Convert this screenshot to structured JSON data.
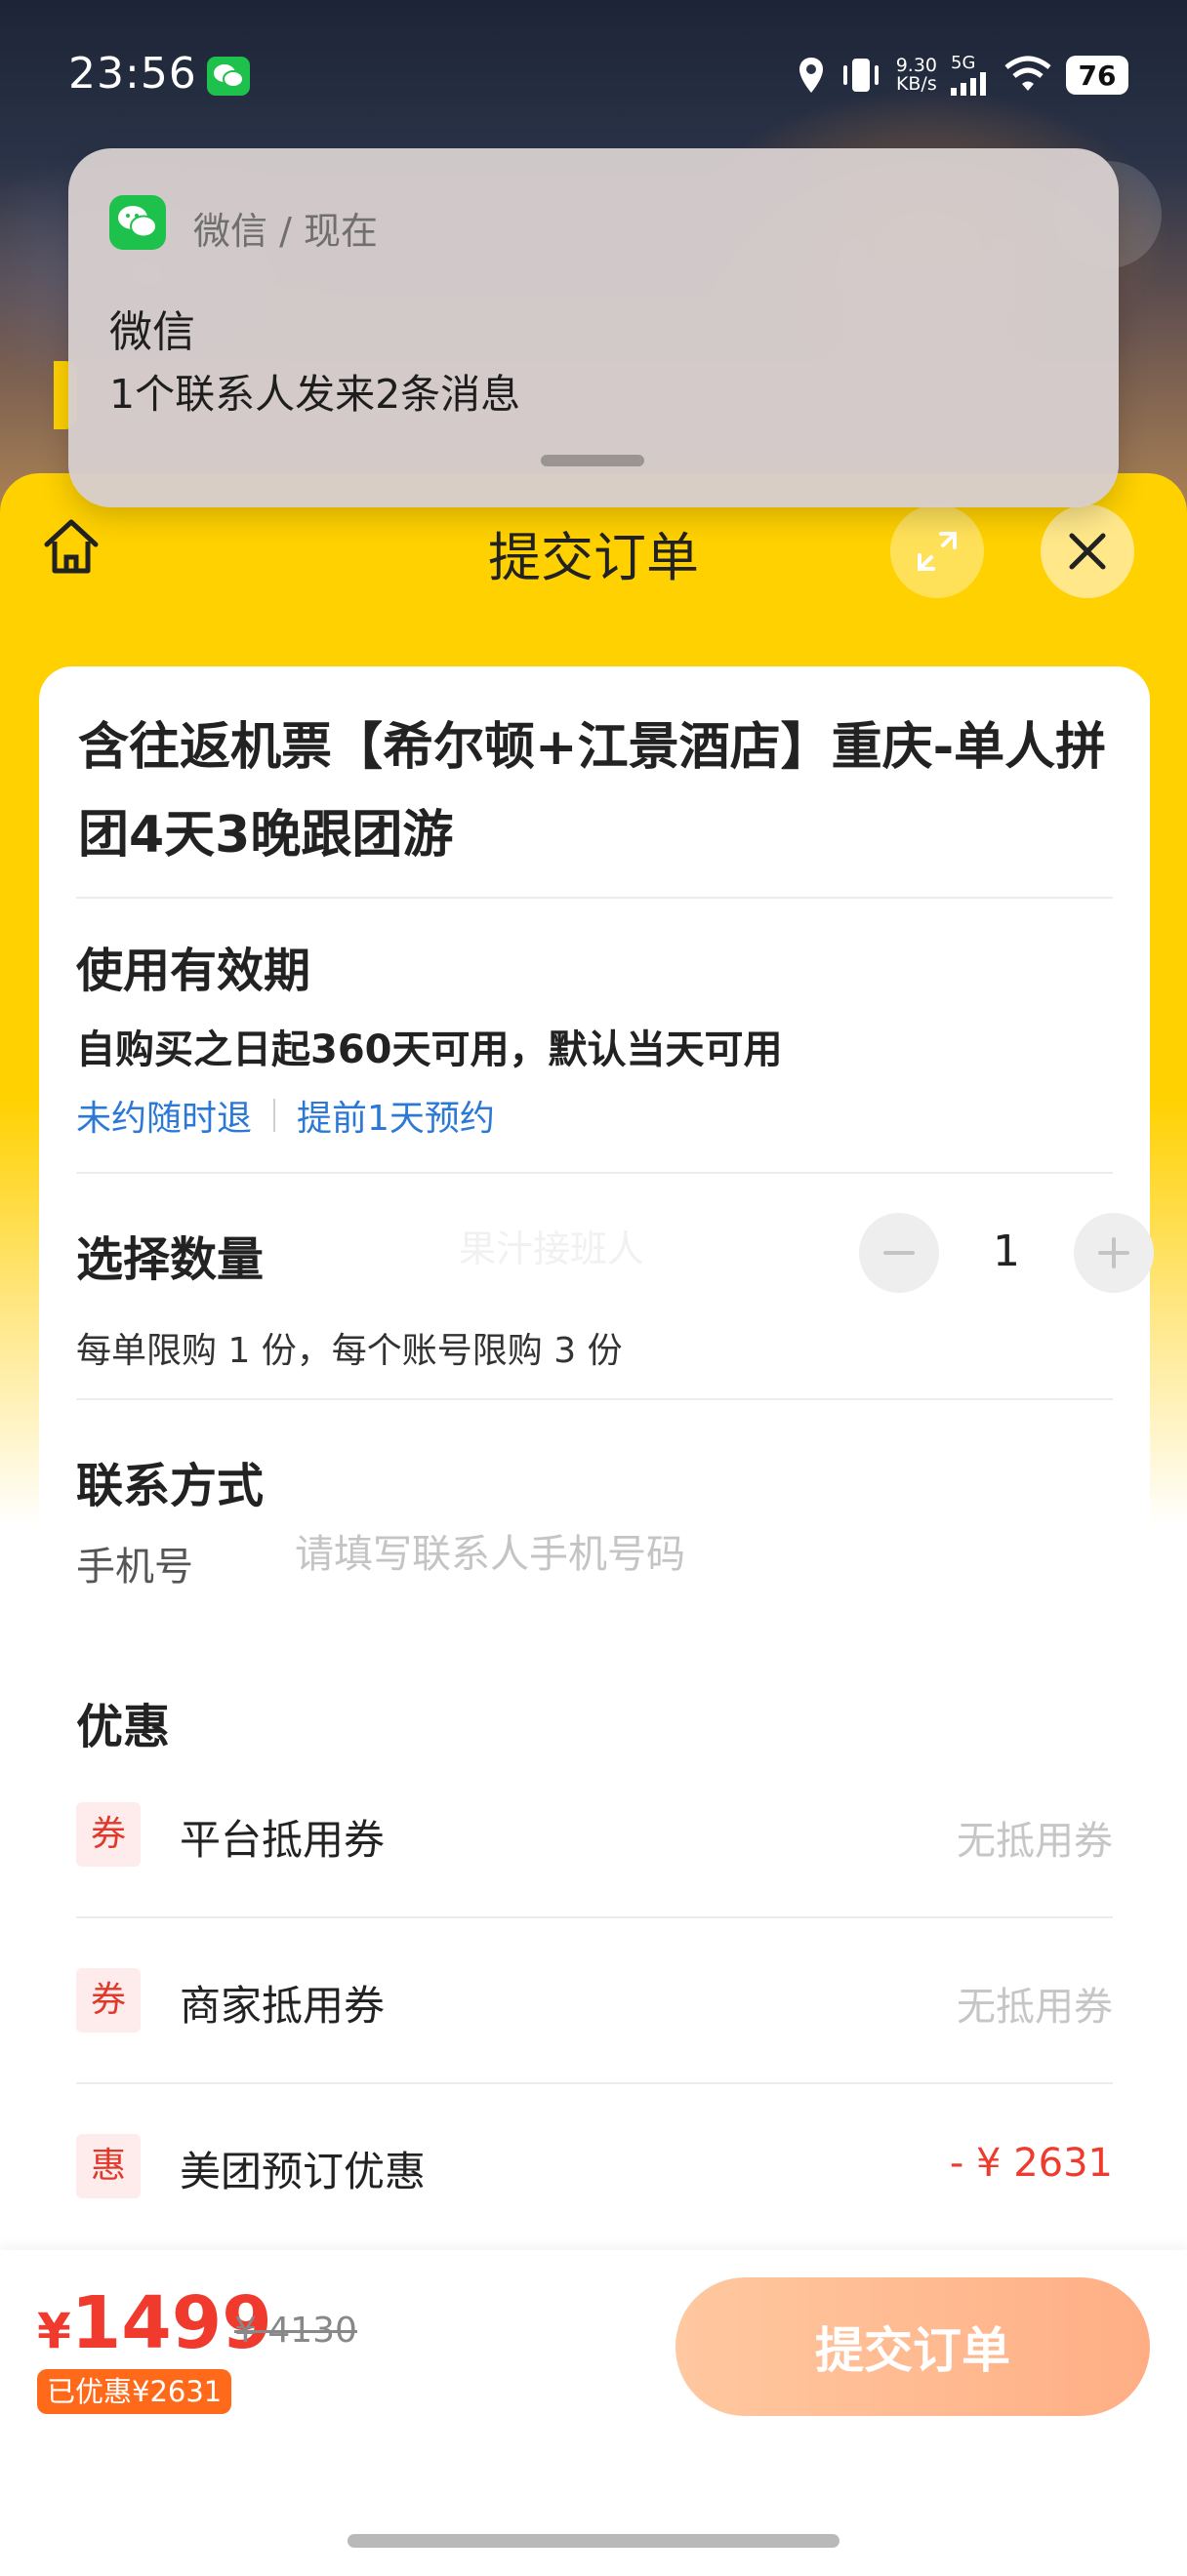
{
  "status_bar": {
    "time": "23:56",
    "net_speed_value": "9.30",
    "net_speed_unit": "KB/s",
    "network": "5G",
    "battery": "76"
  },
  "notification": {
    "app_line": "微信 / 现在",
    "title": "微信",
    "body": "1个联系人发来2条消息"
  },
  "header": {
    "title": "提交订单"
  },
  "product": {
    "title": "含往返机票【希尔顿+江景酒店】重庆-单人拼团4天3晚跟团游"
  },
  "validity": {
    "section_title": "使用有效期",
    "text": "自购买之日起360天可用，默认当天可用",
    "tags": [
      "未约随时退",
      "提前1天预约"
    ]
  },
  "quantity": {
    "section_title": "选择数量",
    "watermark": "果汁接班人",
    "value": "1",
    "limit": "每单限购 1 份，每个账号限购 3 份"
  },
  "contact": {
    "section_title": "联系方式",
    "phone_label": "手机号",
    "phone_placeholder": "请填写联系人手机号码"
  },
  "discounts": {
    "section_title": "优惠",
    "rows": [
      {
        "badge": "券",
        "label": "平台抵用券",
        "value": "无抵用券"
      },
      {
        "badge": "券",
        "label": "商家抵用券",
        "value": "无抵用券"
      },
      {
        "badge": "惠",
        "label": "美团预订优惠",
        "value": "- ¥ 2631"
      }
    ]
  },
  "footer": {
    "price_symbol": "¥",
    "price": "1499",
    "original_price": "¥ 4130",
    "saved": "已优惠¥2631",
    "submit_label": "提交订单"
  },
  "colors": {
    "brand_yellow": "#ffd100",
    "price_red": "#ef3a2d",
    "link_blue": "#2b78d6",
    "wechat_green": "#1fc14d"
  }
}
